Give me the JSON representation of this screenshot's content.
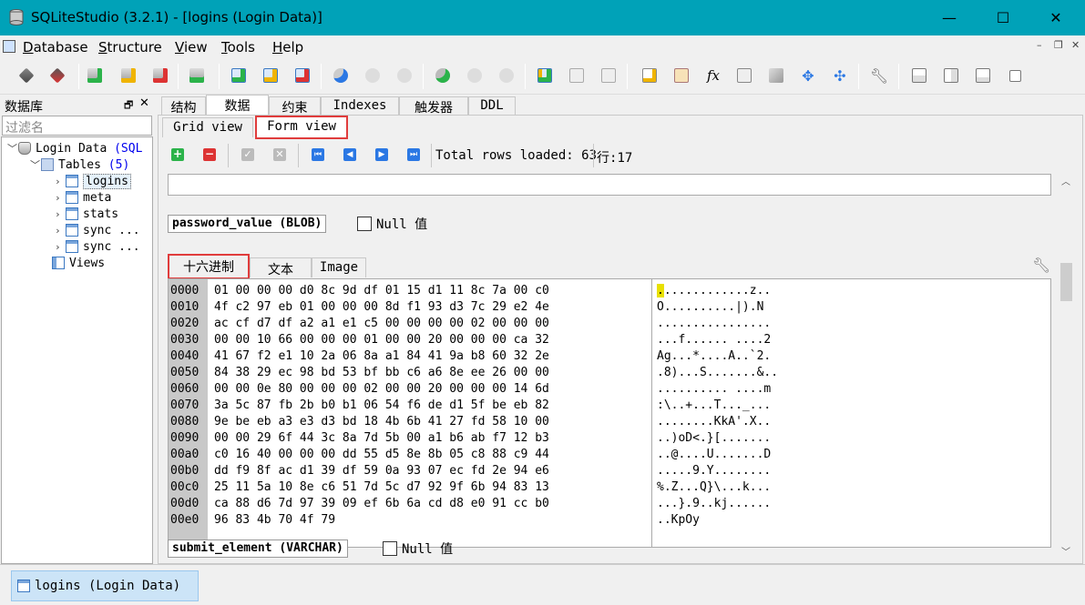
{
  "window": {
    "title": "SQLiteStudio (3.2.1) - [logins (Login Data)]",
    "minimize": "—",
    "maximize": "☐",
    "close": "✕"
  },
  "menu": {
    "items": [
      {
        "ul": "D",
        "rest": "atabase"
      },
      {
        "ul": "S",
        "rest": "tructure"
      },
      {
        "ul": "V",
        "rest": "iew"
      },
      {
        "ul": "T",
        "rest": "ools"
      },
      {
        "ul": "H",
        "rest": "elp"
      }
    ]
  },
  "toolbar_icons": [
    "connect-icon",
    "disconnect-icon",
    "add-database-icon",
    "edit-database-icon",
    "remove-database-icon",
    "import-database-icon",
    "add-table-icon",
    "edit-table-icon",
    "delete-table-icon",
    "add-index-icon",
    "edit-index-icon",
    "delete-index-icon",
    "add-trigger-icon",
    "edit-trigger-icon",
    "delete-trigger-icon",
    "add-view-icon",
    "edit-view-icon",
    "sql-editor-icon",
    "ddl-history-icon",
    "functions-icon",
    "collations-icon",
    "extensions-icon",
    "tile-icon",
    "cascade-icon",
    "config-icon",
    "tile-horizontal-icon",
    "tile-vertical-icon",
    "cascade-windows-icon",
    "restore-icon"
  ],
  "db_panel": {
    "title": "数据库",
    "filter_placeholder": "过滤名",
    "database": "Login Data",
    "database_suffix": "(SQL",
    "tables_label": "Tables",
    "tables_count": "(5)",
    "tables": [
      "logins",
      "meta",
      "stats",
      "sync ...",
      "sync ..."
    ],
    "views_label": "Views"
  },
  "tabs_main": [
    "结构",
    "数据",
    "约束",
    "Indexes",
    "触发器",
    "DDL"
  ],
  "tabs_view": [
    "Grid view",
    "Form view"
  ],
  "grid_toolbar": {
    "total_rows": "Total rows loaded: 63",
    "row_label": "行:",
    "row_value": "17"
  },
  "field": {
    "name": "password_value (BLOB)",
    "null_label": "Null 值"
  },
  "blob_tabs": [
    "十六进制",
    "文本",
    "Image"
  ],
  "hex": {
    "addresses": [
      "0000",
      "0010",
      "0020",
      "0030",
      "0040",
      "0050",
      "0060",
      "0070",
      "0080",
      "0090",
      "00a0",
      "00b0",
      "00c0",
      "00d0",
      "00e0"
    ],
    "bytes": [
      "01 00 00 00 d0 8c 9d df 01 15 d1 11 8c 7a 00 c0",
      "4f c2 97 eb 01 00 00 00 8d f1 93 d3 7c 29 e2 4e",
      "ac cf d7 df a2 a1 e1 c5 00 00 00 00 02 00 00 00",
      "00 00 10 66 00 00 00 01 00 00 20 00 00 00 ca 32",
      "41 67 f2 e1 10 2a 06 8a a1 84 41 9a b8 60 32 2e",
      "84 38 29 ec 98 bd 53 bf bb c6 a6 8e ee 26 00 00",
      "00 00 0e 80 00 00 00 02 00 00 20 00 00 00 14 6d",
      "3a 5c 87 fb 2b b0 b1 06 54 f6 de d1 5f be eb 82",
      "9e be eb a3 e3 d3 bd 18 4b 6b 41 27 fd 58 10 00",
      "00 00 29 6f 44 3c 8a 7d 5b 00 a1 b6 ab f7 12 b3",
      "c0 16 40 00 00 00 dd 55 d5 8e 8b 05 c8 88 c9 44",
      "dd f9 8f ac d1 39 df 59 0a 93 07 ec fd 2e 94 e6",
      "25 11 5a 10 8e c6 51 7d 5c d7 92 9f 6b 94 83 13",
      "ca 88 d6 7d 97 39 09 ef 6b 6a cd d8 e0 91 cc b0",
      "96 83 4b 70 4f 79"
    ],
    "ascii_first_char": ".",
    "ascii": [
      "............z..",
      "O..........|).N",
      "................",
      "...f...... ....2",
      "Ag...*....A..`2.",
      ".8)...S.......&..",
      ".......... ....m",
      ":\\..+...T..._...",
      "........KkA'.X..",
      "..)oD<.}[.......",
      "..@....U.......D",
      ".....9.Y........",
      "%.Z...Q}\\...k...",
      "...}.9..kj......",
      "..KpOy"
    ]
  },
  "field2": {
    "name": "submit_element (VARCHAR)",
    "null_label": "Null 值"
  },
  "taskbar": {
    "item": "logins (Login Data)"
  }
}
